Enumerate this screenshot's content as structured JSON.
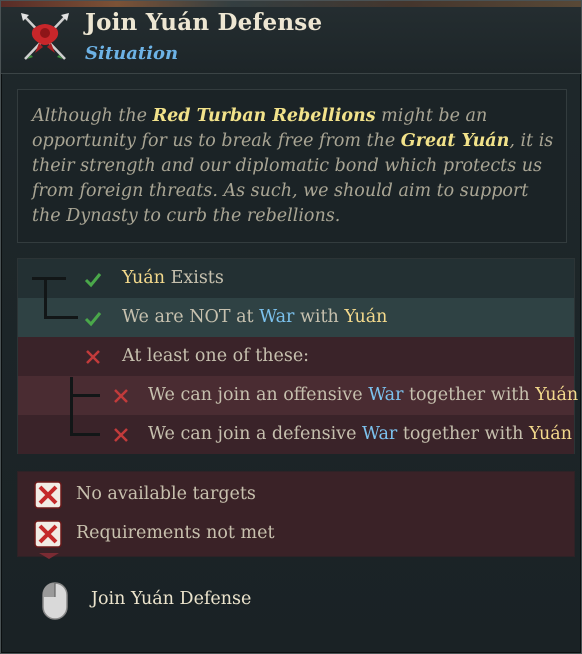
{
  "header": {
    "title": "Join Yuán Defense",
    "subtitle": "Situation",
    "emblem_icon": "red-crossed-banners-icon"
  },
  "description": {
    "p1": "Although the ",
    "h1": "Red Turban Rebellions",
    "p2": " might be an opportunity for us to break free from the ",
    "h2": "Great Yuán",
    "p3": ", it is their strength and our diplomatic bond which protects us from foreign threats. As such, we should aim to support the Dynasty to curb the rebellions."
  },
  "requirements": [
    {
      "status": "met",
      "parts": [
        [
          "Yuán",
          "gold"
        ],
        [
          " Exists",
          "plain"
        ]
      ]
    },
    {
      "status": "met",
      "parts": [
        [
          "We are NOT at ",
          "plain"
        ],
        [
          "War",
          "blue"
        ],
        [
          " with ",
          "plain"
        ],
        [
          "Yuán",
          "gold"
        ]
      ]
    },
    {
      "status": "not_met",
      "parts": [
        [
          "At least one of these:",
          "plain"
        ]
      ]
    },
    {
      "status": "not_met",
      "parts": [
        [
          "We can join an offensive ",
          "plain"
        ],
        [
          "War",
          "blue"
        ],
        [
          " together with ",
          "plain"
        ],
        [
          "Yuán",
          "gold"
        ]
      ]
    },
    {
      "status": "not_met",
      "parts": [
        [
          "We can join a defensive ",
          "plain"
        ],
        [
          "War",
          "blue"
        ],
        [
          " together with ",
          "plain"
        ],
        [
          "Yuán",
          "gold"
        ]
      ]
    }
  ],
  "status": {
    "no_targets": "No available targets",
    "requirements_not_met": "Requirements not met"
  },
  "action": {
    "label": "Join Yuán Defense",
    "icon": "mouse-left-click-icon"
  },
  "colors": {
    "accent_gold": "#f3d98c",
    "accent_blue": "#7cc2ee",
    "check_green": "#4aa84a",
    "cross_red": "#c23b3b"
  }
}
